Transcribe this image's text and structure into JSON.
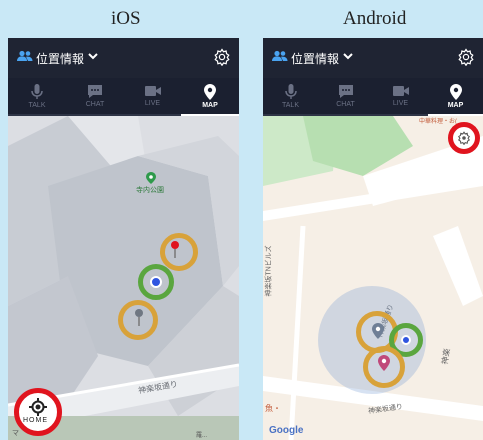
{
  "captions": {
    "ios": "iOS",
    "android": "Android"
  },
  "header": {
    "title": "位置情報"
  },
  "tabs": [
    {
      "label": "TALK",
      "icon": "microphone-icon"
    },
    {
      "label": "CHAT",
      "icon": "chat-icon"
    },
    {
      "label": "LIVE",
      "icon": "video-icon"
    },
    {
      "label": "MAP",
      "icon": "map-pin-icon",
      "active": true
    }
  ],
  "ios_map": {
    "park_label": "寺内公園",
    "street_label": "神楽坂通り",
    "home_label": "HOME",
    "bottom_left": "マ",
    "bottom_right": "羅..."
  },
  "android_map": {
    "top_label": "中華料理・お(",
    "building_label": "神楽坂TNビルズ",
    "street_label_1": "神楽坂通り",
    "street_label_2": "神楽坂通り",
    "side_label": "神楽",
    "fish_label": "魚・",
    "google": "Google"
  },
  "colors": {
    "highlight_gold": "#d8a23a",
    "highlight_green": "#5aa63f",
    "highlight_red": "#e0141e",
    "header_bg": "#1f2433"
  }
}
